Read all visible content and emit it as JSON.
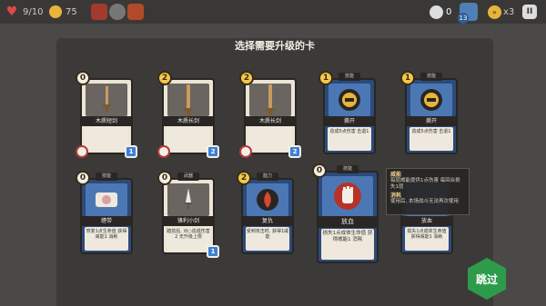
{
  "hud": {
    "hp": "9/10",
    "gold": "75",
    "stat_value": "0",
    "deck_count": "13",
    "speed": "x3"
  },
  "screen_title": "选择需要升级的卡",
  "cards": [
    {
      "name": "木质短剑",
      "cost": "0",
      "level": "1",
      "desc": ""
    },
    {
      "name": "木质长剑",
      "cost": "2",
      "level": "2",
      "desc": ""
    },
    {
      "name": "木质长剑",
      "cost": "2",
      "level": "2",
      "desc": ""
    },
    {
      "name": "撕开",
      "cost": "1",
      "type": "技能",
      "desc": "造成5点伤害 击退1"
    },
    {
      "name": "撕开",
      "cost": "1",
      "type": "技能",
      "desc": "造成5点伤害 击退1"
    },
    {
      "name": "缠带",
      "cost": "0",
      "type": "技能",
      "desc": "恢复1点生命值 获得威能1 消耗"
    },
    {
      "name": "锋利小剑",
      "cost": "0",
      "type": "武器",
      "level": "1",
      "desc": "踏前后, 对○造成伤害 2 无升级上限"
    },
    {
      "name": "复仇",
      "cost": "2",
      "type": "能力",
      "desc": "受到攻击时, 获得1威能"
    }
  ],
  "big_card": {
    "name": "放血",
    "cost": "0",
    "type": "技能",
    "desc": "损失1点成体生命值 获得威能1 消耗"
  },
  "ghost_card": {
    "name": "放血",
    "desc": "损失1点成体生命值 获得威能1 消耗"
  },
  "tooltip": {
    "t1": "威能",
    "d1": "每层威能提供1点伤害 每回合损失1层",
    "t2": "消耗",
    "d2": "使用后, 本场战斗无法再次使用"
  },
  "skip_label": "跳过"
}
